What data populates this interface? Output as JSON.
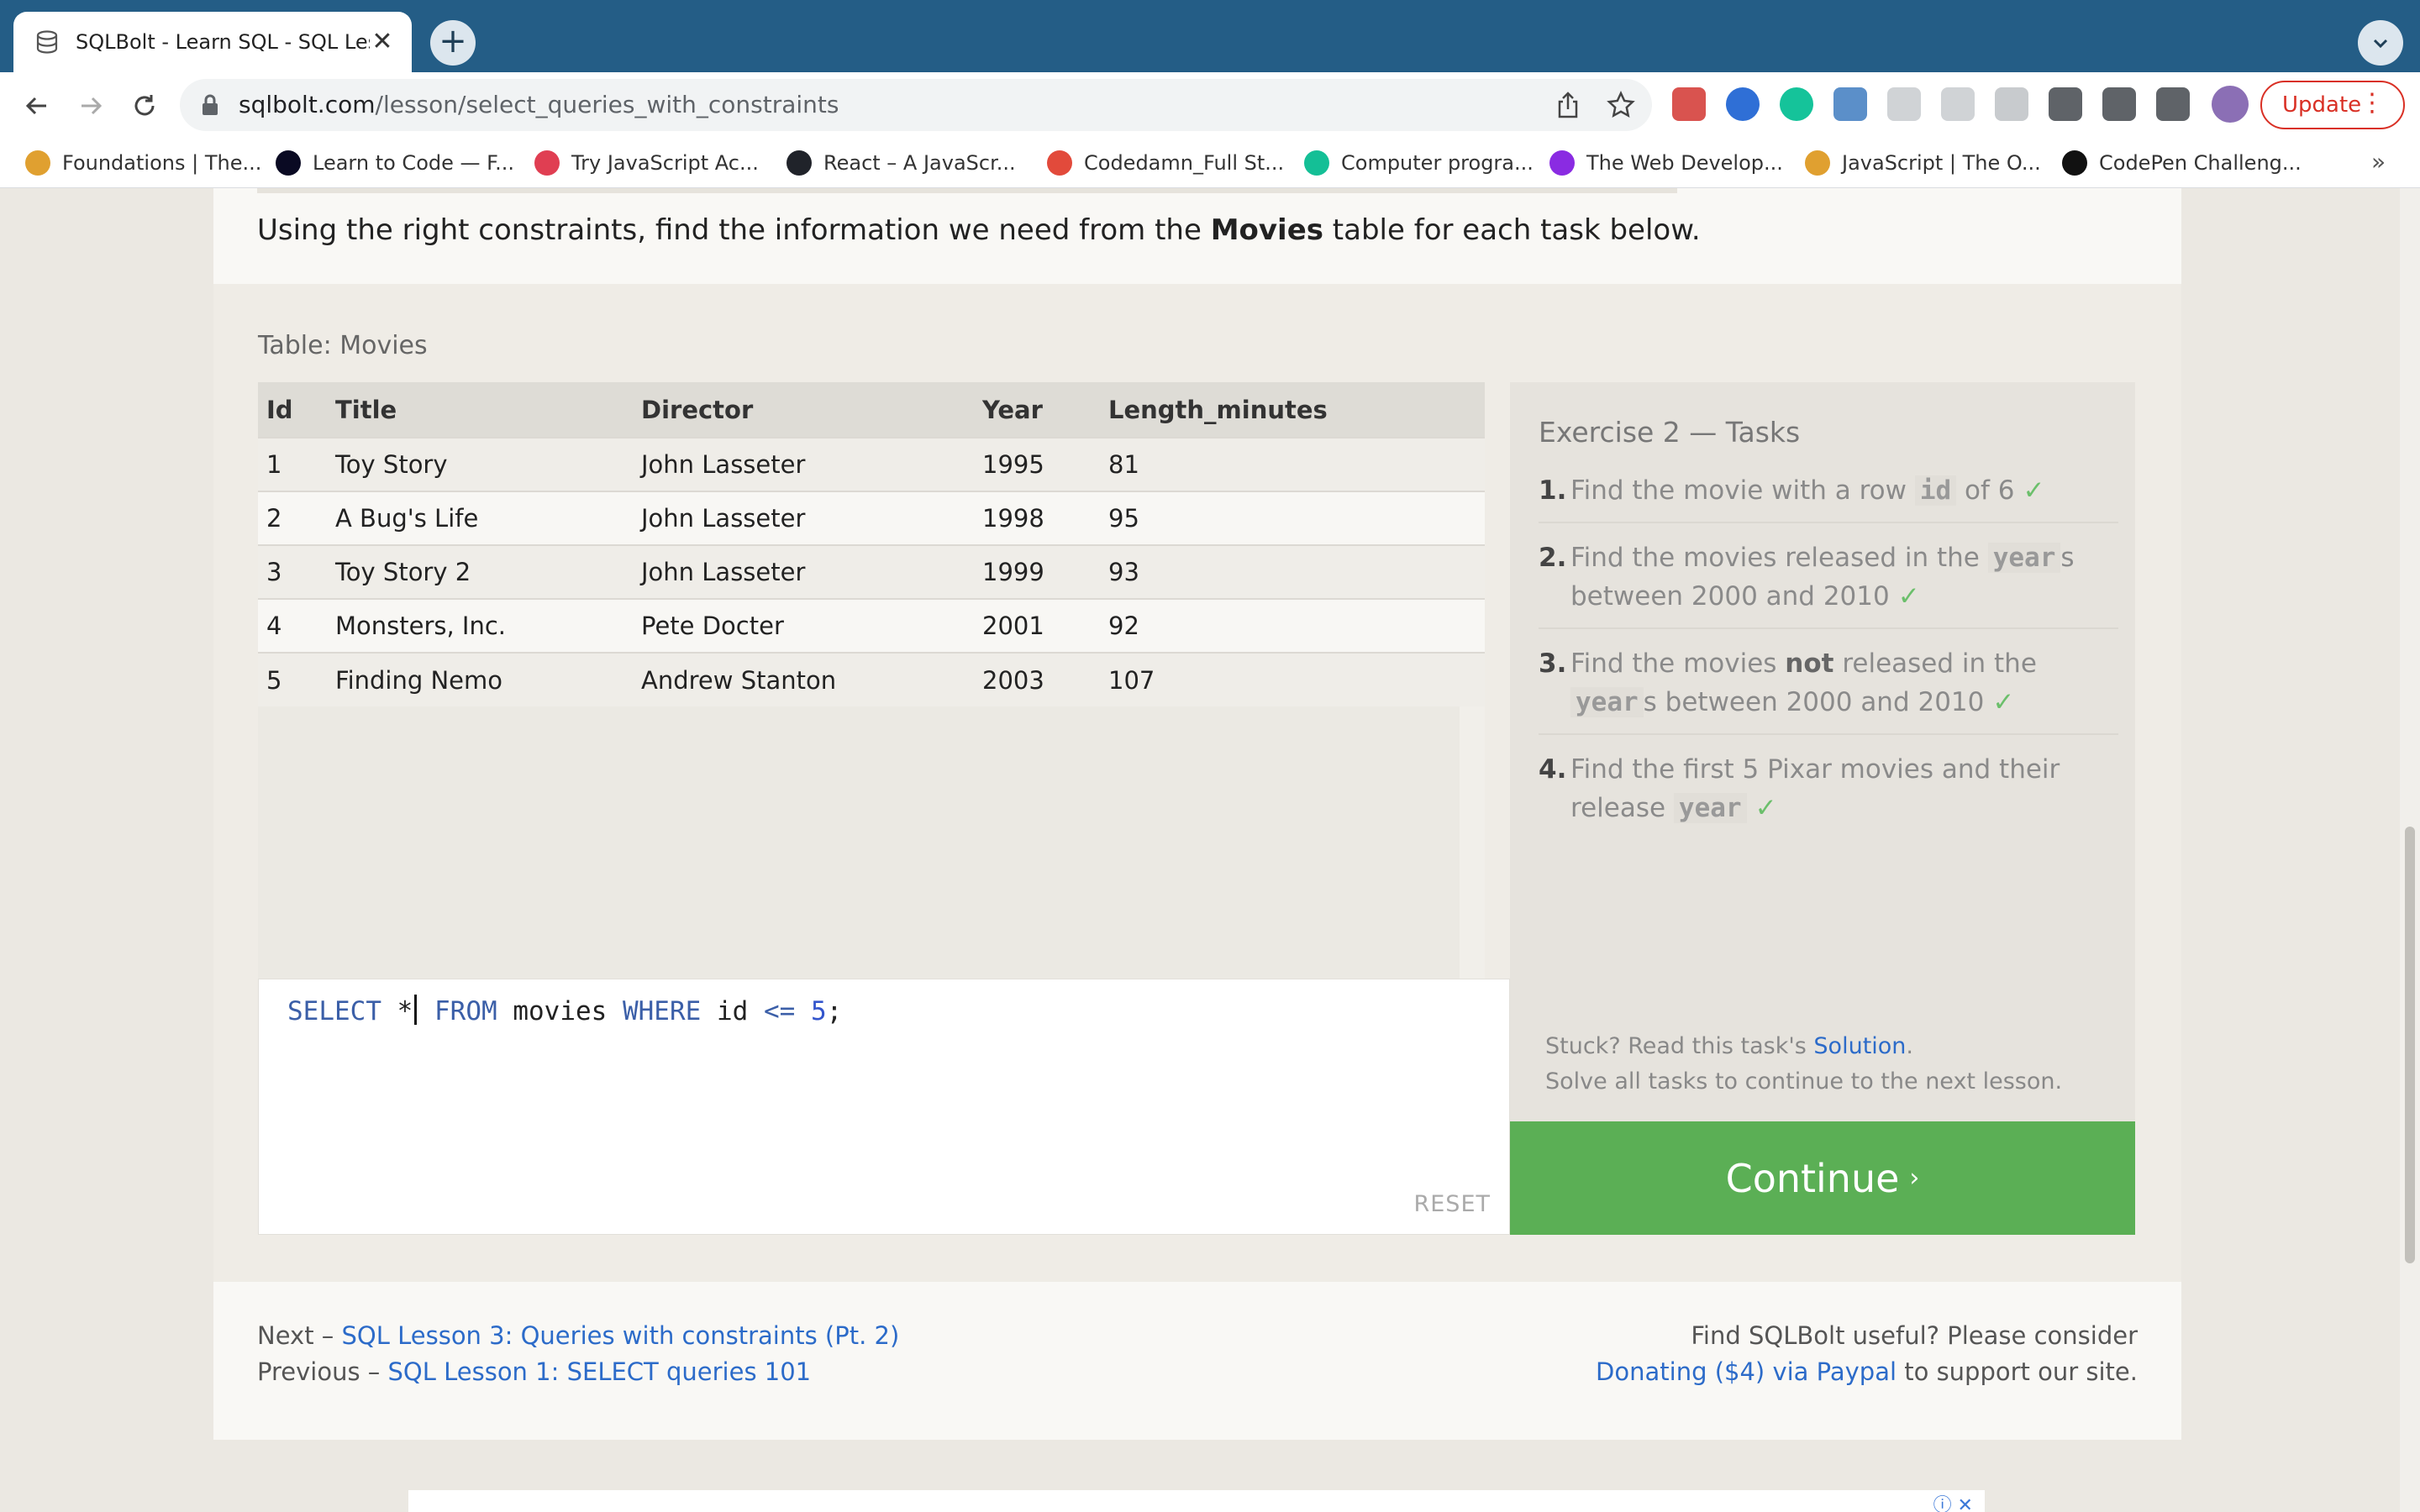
{
  "browser": {
    "tab_title": "SQLBolt - Learn SQL - SQL Les",
    "tab_close": "✕",
    "new_tab": "+",
    "url_host": "sqlbolt.com",
    "url_path": "/lesson/select_queries_with_constraints",
    "update_label": "Update",
    "bookmarks": [
      {
        "label": "Foundations | The...",
        "color": "#e0a030"
      },
      {
        "label": "Learn to Code — F...",
        "color": "#0a0a23"
      },
      {
        "label": "Try JavaScript Ac...",
        "color": "#e03e52"
      },
      {
        "label": "React – A JavaScr...",
        "color": "#20232a"
      },
      {
        "label": "Codedamn_Full St...",
        "color": "#e24a3b"
      },
      {
        "label": "Computer progra...",
        "color": "#14bf96"
      },
      {
        "label": "The Web Develop...",
        "color": "#8a2be2"
      },
      {
        "label": "JavaScript | The O...",
        "color": "#e0a030"
      },
      {
        "label": "CodePen Challeng...",
        "color": "#111111"
      }
    ],
    "bookmarks_more": "»"
  },
  "lesson": {
    "instruction_pre": "Using the right constraints, find the information we need from the ",
    "instruction_bold": "Movies",
    "instruction_post": " table for each task below.",
    "table_label": "Table: Movies"
  },
  "table": {
    "headers": [
      "Id",
      "Title",
      "Director",
      "Year",
      "Length_minutes"
    ],
    "rows": [
      [
        "1",
        "Toy Story",
        "John Lasseter",
        "1995",
        "81"
      ],
      [
        "2",
        "A Bug's Life",
        "John Lasseter",
        "1998",
        "95"
      ],
      [
        "3",
        "Toy Story 2",
        "John Lasseter",
        "1999",
        "93"
      ],
      [
        "4",
        "Monsters, Inc.",
        "Pete Docter",
        "2001",
        "92"
      ],
      [
        "5",
        "Finding Nemo",
        "Andrew Stanton",
        "2003",
        "107"
      ]
    ]
  },
  "editor": {
    "kw_select": "SELECT",
    "star": "*",
    "kw_from": "FROM",
    "table": "movies",
    "kw_where": "WHERE",
    "column": "id",
    "operator": "<=",
    "value": "5",
    "semicolon": ";",
    "reset_label": "RESET"
  },
  "tasks": {
    "heading": "Exercise 2 — Tasks",
    "items": [
      {
        "num": "1.",
        "pre": "Find the movie with a row ",
        "code": "id",
        "post": " of 6",
        "strong": "",
        "tail": "",
        "check": "✓"
      },
      {
        "num": "2.",
        "pre": "Find the movies released in the ",
        "code": "year",
        "post": "s between 2000 and 2010",
        "strong": "",
        "tail": "",
        "check": "✓"
      },
      {
        "num": "3.",
        "pre": "Find the movies ",
        "strong": "not",
        "tail": " released in the ",
        "code": "year",
        "post": "s between 2000 and 2010",
        "check": "✓"
      },
      {
        "num": "4.",
        "pre": "Find the first 5 Pixar movies and their release ",
        "code": "year",
        "post": "",
        "strong": "",
        "tail": "",
        "check": "✓"
      }
    ],
    "stuck_pre": "Stuck? Read this task's ",
    "stuck_link": "Solution",
    "stuck_post": ".",
    "solve_all": "Solve all tasks to continue to the next lesson."
  },
  "continue": {
    "label": "Continue",
    "arrow": "›"
  },
  "footer": {
    "next_prefix": "Next – ",
    "next_link": "SQL Lesson 3: Queries with constraints (Pt. 2)",
    "prev_prefix": "Previous – ",
    "prev_link": "SQL Lesson 1: SELECT queries 101",
    "support_line1": "Find SQLBolt useful? Please consider",
    "donate_link": "Donating ($4) via Paypal",
    "support_tail": " to support our site."
  },
  "ad": {
    "icons": "ⓘ ✕"
  }
}
